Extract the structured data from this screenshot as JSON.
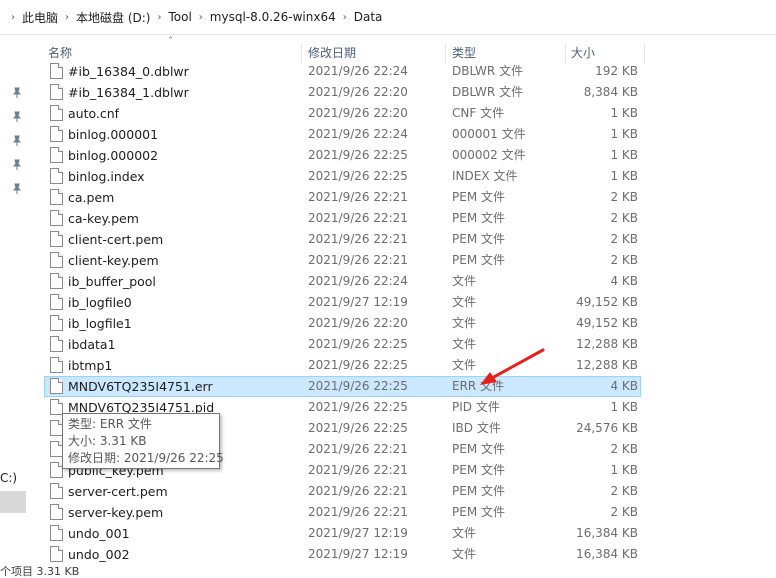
{
  "breadcrumb": {
    "items": [
      "此电脑",
      "本地磁盘 (D:)",
      "Tool",
      "mysql-8.0.26-winx64",
      "Data"
    ]
  },
  "columns": {
    "name": "名称",
    "modified": "修改日期",
    "type": "类型",
    "size": "大小"
  },
  "files": [
    {
      "name": "#ib_16384_0.dblwr",
      "modified": "2021/9/26 22:24",
      "type": "DBLWR 文件",
      "size": "192 KB"
    },
    {
      "name": "#ib_16384_1.dblwr",
      "modified": "2021/9/26 22:20",
      "type": "DBLWR 文件",
      "size": "8,384 KB"
    },
    {
      "name": "auto.cnf",
      "modified": "2021/9/26 22:20",
      "type": "CNF 文件",
      "size": "1 KB"
    },
    {
      "name": "binlog.000001",
      "modified": "2021/9/26 22:24",
      "type": "000001 文件",
      "size": "1 KB"
    },
    {
      "name": "binlog.000002",
      "modified": "2021/9/26 22:25",
      "type": "000002 文件",
      "size": "1 KB"
    },
    {
      "name": "binlog.index",
      "modified": "2021/9/26 22:25",
      "type": "INDEX 文件",
      "size": "1 KB"
    },
    {
      "name": "ca.pem",
      "modified": "2021/9/26 22:21",
      "type": "PEM 文件",
      "size": "2 KB"
    },
    {
      "name": "ca-key.pem",
      "modified": "2021/9/26 22:21",
      "type": "PEM 文件",
      "size": "2 KB"
    },
    {
      "name": "client-cert.pem",
      "modified": "2021/9/26 22:21",
      "type": "PEM 文件",
      "size": "2 KB"
    },
    {
      "name": "client-key.pem",
      "modified": "2021/9/26 22:21",
      "type": "PEM 文件",
      "size": "2 KB"
    },
    {
      "name": "ib_buffer_pool",
      "modified": "2021/9/26 22:24",
      "type": "文件",
      "size": "4 KB"
    },
    {
      "name": "ib_logfile0",
      "modified": "2021/9/27 12:19",
      "type": "文件",
      "size": "49,152 KB"
    },
    {
      "name": "ib_logfile1",
      "modified": "2021/9/26 22:20",
      "type": "文件",
      "size": "49,152 KB"
    },
    {
      "name": "ibdata1",
      "modified": "2021/9/26 22:25",
      "type": "文件",
      "size": "12,288 KB"
    },
    {
      "name": "ibtmp1",
      "modified": "2021/9/26 22:25",
      "type": "文件",
      "size": "12,288 KB"
    },
    {
      "name": "MNDV6TQ235I4751.err",
      "modified": "2021/9/26 22:25",
      "type": "ERR 文件",
      "size": "4 KB",
      "selected": true
    },
    {
      "name": "MNDV6TQ235I4751.pid",
      "modified": "2021/9/26 22:25",
      "type": "PID 文件",
      "size": "1 KB"
    },
    {
      "name": "",
      "modified": "2021/9/26 22:25",
      "type": "IBD 文件",
      "size": "24,576 KB"
    },
    {
      "name": "",
      "modified": "2021/9/26 22:21",
      "type": "PEM 文件",
      "size": "2 KB"
    },
    {
      "name": "public_key.pem",
      "modified": "2021/9/26 22:21",
      "type": "PEM 文件",
      "size": "1 KB"
    },
    {
      "name": "server-cert.pem",
      "modified": "2021/9/26 22:21",
      "type": "PEM 文件",
      "size": "2 KB"
    },
    {
      "name": "server-key.pem",
      "modified": "2021/9/26 22:21",
      "type": "PEM 文件",
      "size": "2 KB"
    },
    {
      "name": "undo_001",
      "modified": "2021/9/27 12:19",
      "type": "文件",
      "size": "16,384 KB"
    },
    {
      "name": "undo_002",
      "modified": "2021/9/27 12:19",
      "type": "文件",
      "size": "16,384 KB"
    }
  ],
  "tooltip": {
    "type_line": "类型: ERR 文件",
    "size_line": "大小: 3.31 KB",
    "date_line": "修改日期: 2021/9/26 22:25"
  },
  "nav": {
    "drive_label": "C:)"
  },
  "status": {
    "text": "个项目  3.31 KB"
  },
  "colors": {
    "selection": "#cce8ff",
    "selection_border": "#99d1ff",
    "annotation_arrow": "#e8201c"
  },
  "icons": {
    "pins": [
      "pin-icon",
      "pin-icon",
      "pin-icon",
      "pin-icon",
      "pin-icon"
    ],
    "file": "file-icon",
    "crumb_separator": "chevron-right-icon",
    "sort": "sort-up-icon"
  }
}
